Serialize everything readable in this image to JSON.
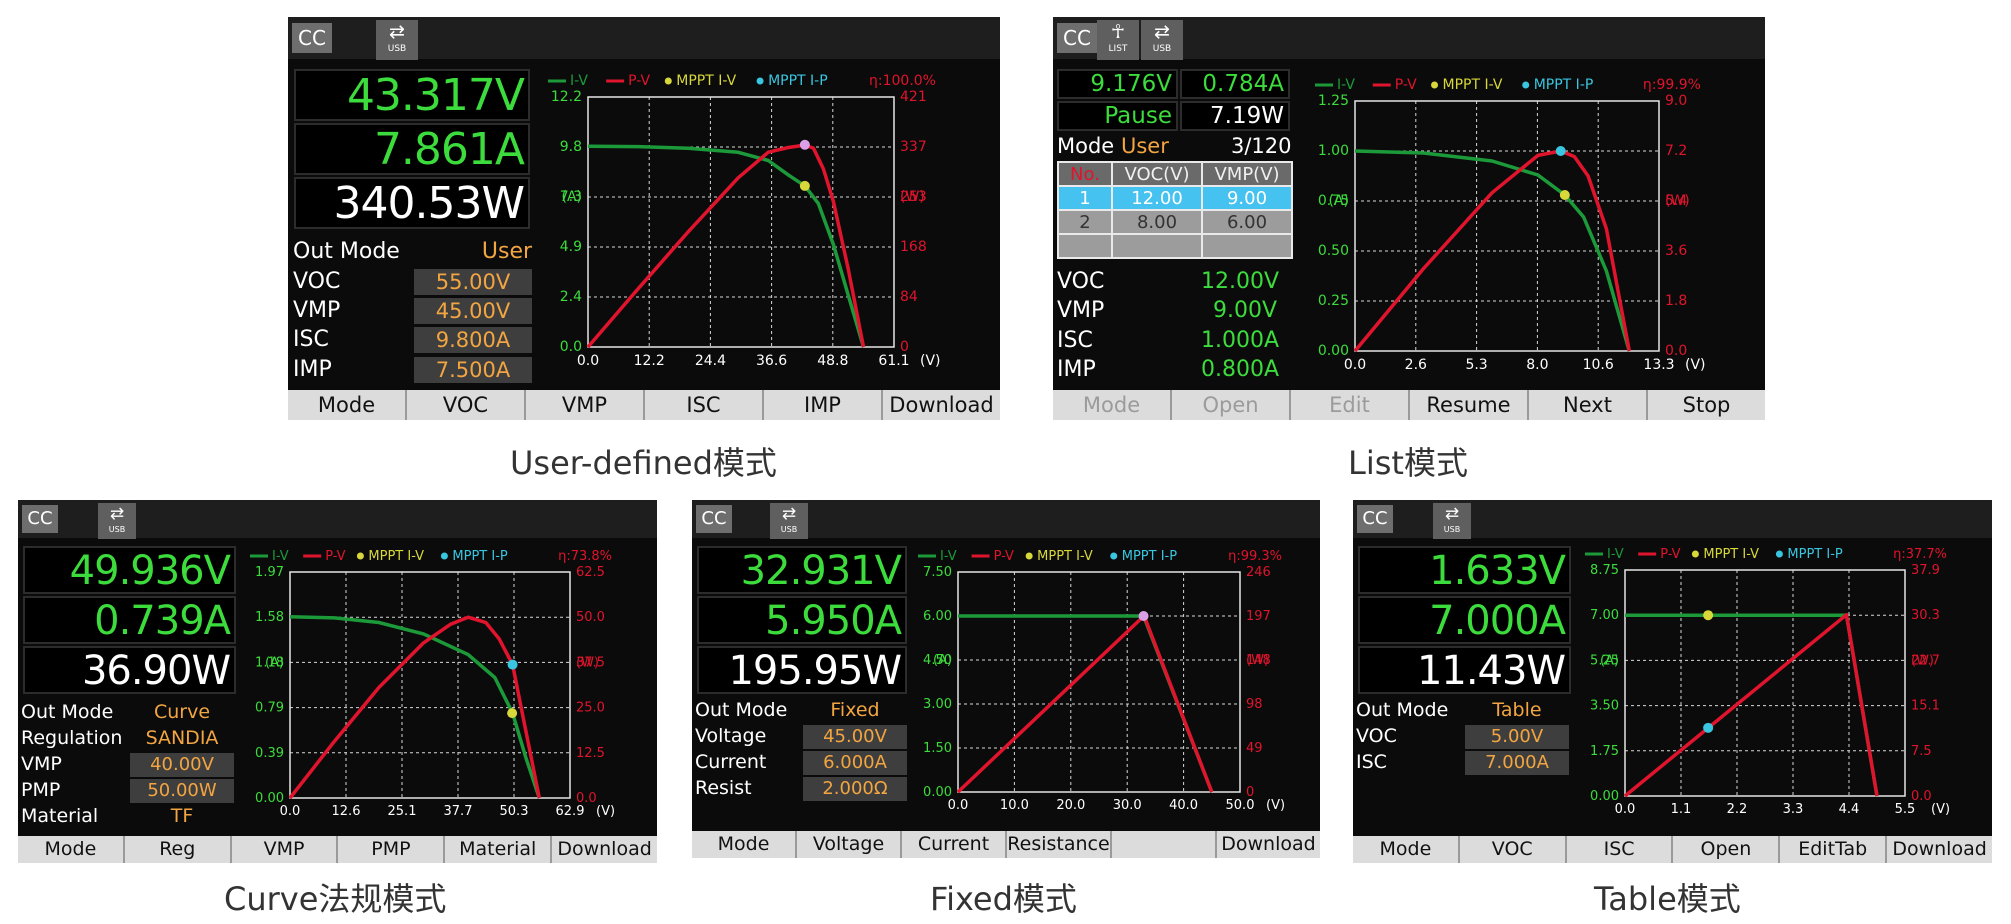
{
  "colors": {
    "green": "#3ddc3d",
    "white": "#ffffff",
    "orange": "#f2a541",
    "iv_curve": "#1c9a3a",
    "pv_curve": "#e0142c",
    "mppt_iv": "#d8d83a",
    "mppt_ip": "#39c6e0",
    "mpp_marker": "#d9a0e8"
  },
  "icons": {
    "usb": "usb-icon",
    "list": "list-run-icon"
  },
  "legend": {
    "iv": "I-V",
    "pv": "P-V",
    "mppt_iv": "MPPT I-V",
    "mppt_ip": "MPPT I-P"
  },
  "units": {
    "left": "(A)",
    "right": "(W)",
    "bottom": "(V)"
  },
  "panels": {
    "user": {
      "caption": "User-defined模式",
      "status": {
        "cc": "CC",
        "usb": "USB"
      },
      "readings": {
        "voltage": "43.317V",
        "current": "7.861A",
        "power": "340.53W"
      },
      "params": [
        {
          "label": "Out Mode",
          "value": "User"
        },
        {
          "label": "VOC",
          "value": "55.00V"
        },
        {
          "label": "VMP",
          "value": "45.00V"
        },
        {
          "label": "ISC",
          "value": "9.800A"
        },
        {
          "label": "IMP",
          "value": "7.500A"
        }
      ],
      "eta": "η:100.0%",
      "softkeys": [
        "Mode",
        "VOC",
        "VMP",
        "ISC",
        "IMP",
        "Download"
      ]
    },
    "list": {
      "caption": "List模式",
      "status": {
        "cc": "CC",
        "list": "LIST",
        "usb": "USB"
      },
      "readings": {
        "voltage": "9.176V",
        "current": "0.784A",
        "state": "Pause",
        "power": "7.19W"
      },
      "mode": {
        "label": "Mode",
        "value": "User",
        "step": "3/120"
      },
      "table": {
        "headers": [
          "No.",
          "VOC(V)",
          "VMP(V)"
        ],
        "rows": [
          [
            "1",
            "12.00",
            "9.00"
          ],
          [
            "2",
            "8.00",
            "6.00"
          ]
        ]
      },
      "params": [
        {
          "label": "VOC",
          "value": "12.00V"
        },
        {
          "label": "VMP",
          "value": "9.00V"
        },
        {
          "label": "ISC",
          "value": "1.000A"
        },
        {
          "label": "IMP",
          "value": "0.800A"
        }
      ],
      "eta": "η:99.9%",
      "softkeys": [
        "Mode",
        "Open",
        "Edit",
        "Resume",
        "Next",
        "Stop"
      ],
      "softkeys_disabled": [
        "Mode",
        "Open",
        "Edit"
      ]
    },
    "curve": {
      "caption": "Curve法规模式",
      "status": {
        "cc": "CC",
        "usb": "USB"
      },
      "readings": {
        "voltage": "49.936V",
        "current": "0.739A",
        "power": "36.90W"
      },
      "params": [
        {
          "label": "Out Mode",
          "value": "Curve"
        },
        {
          "label": "Regulation",
          "value": "SANDIA"
        },
        {
          "label": "VMP",
          "value": "40.00V"
        },
        {
          "label": "PMP",
          "value": "50.00W"
        },
        {
          "label": "Material",
          "value": "TF"
        }
      ],
      "eta": "η:73.8%",
      "softkeys": [
        "Mode",
        "Reg",
        "VMP",
        "PMP",
        "Material",
        "Download"
      ]
    },
    "fixed": {
      "caption": "Fixed模式",
      "status": {
        "cc": "CC",
        "usb": "USB"
      },
      "readings": {
        "voltage": "32.931V",
        "current": "5.950A",
        "power": "195.95W"
      },
      "params": [
        {
          "label": "Out Mode",
          "value": "Fixed"
        },
        {
          "label": "Voltage",
          "value": "45.00V"
        },
        {
          "label": "Current",
          "value": "6.000A"
        },
        {
          "label": "Resist",
          "value": "2.000Ω"
        }
      ],
      "eta": "η:99.3%",
      "softkeys": [
        "Mode",
        "Voltage",
        "Current",
        "Resistance",
        "",
        "Download"
      ]
    },
    "table": {
      "caption": "Table模式",
      "status": {
        "cc": "CC",
        "usb": "USB"
      },
      "readings": {
        "voltage": "1.633V",
        "current": "7.000A",
        "power": "11.43W"
      },
      "params": [
        {
          "label": "Out Mode",
          "value": "Table"
        },
        {
          "label": "VOC",
          "value": "5.00V"
        },
        {
          "label": "ISC",
          "value": "7.000A"
        }
      ],
      "eta": "η:37.7%",
      "softkeys": [
        "Mode",
        "VOC",
        "ISC",
        "Open",
        "EditTab",
        "Download"
      ]
    }
  },
  "chart_data": [
    {
      "type": "line",
      "panel": "user",
      "x_ticks": [
        "0.0",
        "12.2",
        "24.4",
        "36.6",
        "48.8",
        "61.1"
      ],
      "y_left_ticks": [
        "0.0",
        "2.4",
        "4.9",
        "7.3",
        "9.8",
        "12.2"
      ],
      "y_right_ticks": [
        "0",
        "84",
        "168",
        "253",
        "337",
        "421"
      ],
      "xlim": [
        0,
        61.1
      ],
      "ylim_left": [
        0,
        12.2
      ],
      "ylim_right": [
        0,
        421
      ],
      "series": [
        {
          "name": "I-V",
          "axis": "left",
          "points": [
            [
              0,
              9.8
            ],
            [
              10,
              9.78
            ],
            [
              20,
              9.7
            ],
            [
              30,
              9.5
            ],
            [
              36,
              9.1
            ],
            [
              40,
              8.4
            ],
            [
              43.3,
              7.86
            ],
            [
              46,
              7.0
            ],
            [
              49,
              5.0
            ],
            [
              52,
              2.5
            ],
            [
              55,
              0
            ]
          ]
        },
        {
          "name": "P-V",
          "axis": "right",
          "points": [
            [
              0,
              0
            ],
            [
              10,
              98
            ],
            [
              20,
              194
            ],
            [
              30,
              285
            ],
            [
              36,
              328
            ],
            [
              40,
              336
            ],
            [
              43.3,
              340
            ],
            [
              45,
              335
            ],
            [
              47,
              300
            ],
            [
              49,
              245
            ],
            [
              52,
              130
            ],
            [
              55,
              0
            ]
          ]
        }
      ],
      "markers": [
        {
          "name": "MPPT I-V",
          "axis": "left",
          "x": 43.3,
          "y": 7.86
        },
        {
          "name": "MPP",
          "axis": "right",
          "x": 43.3,
          "y": 340.5
        }
      ],
      "grid": true
    },
    {
      "type": "line",
      "panel": "list",
      "x_ticks": [
        "0.0",
        "2.6",
        "5.3",
        "8.0",
        "10.6",
        "13.3"
      ],
      "y_left_ticks": [
        "0.00",
        "0.25",
        "0.50",
        "0.75",
        "1.00",
        "1.25"
      ],
      "y_right_ticks": [
        "0.0",
        "1.8",
        "3.6",
        "5.4",
        "7.2",
        "9.0"
      ],
      "xlim": [
        0,
        13.3
      ],
      "ylim_left": [
        0,
        1.25
      ],
      "ylim_right": [
        0,
        9.0
      ],
      "series": [
        {
          "name": "I-V",
          "axis": "left",
          "points": [
            [
              0,
              1.0
            ],
            [
              3,
              0.99
            ],
            [
              6,
              0.95
            ],
            [
              8,
              0.88
            ],
            [
              9.18,
              0.78
            ],
            [
              10,
              0.67
            ],
            [
              11,
              0.4
            ],
            [
              12,
              0
            ]
          ]
        },
        {
          "name": "P-V",
          "axis": "right",
          "points": [
            [
              0,
              0
            ],
            [
              3,
              2.97
            ],
            [
              6,
              5.7
            ],
            [
              8,
              7.04
            ],
            [
              9,
              7.2
            ],
            [
              9.6,
              7.0
            ],
            [
              10.2,
              6.3
            ],
            [
              11,
              4.4
            ],
            [
              12,
              0
            ]
          ]
        }
      ],
      "markers": [
        {
          "name": "MPPT I-V",
          "axis": "left",
          "x": 9.18,
          "y": 0.78
        },
        {
          "name": "MPPT I-P",
          "axis": "right",
          "x": 9.0,
          "y": 7.2
        }
      ],
      "grid": true
    },
    {
      "type": "line",
      "panel": "curve",
      "x_ticks": [
        "0.0",
        "12.6",
        "25.1",
        "37.7",
        "50.3",
        "62.9"
      ],
      "y_left_ticks": [
        "0.00",
        "0.39",
        "0.79",
        "1.18",
        "1.58",
        "1.97"
      ],
      "y_right_ticks": [
        "0.0",
        "12.5",
        "25.0",
        "37.5",
        "50.0",
        "62.5"
      ],
      "xlim": [
        0,
        62.9
      ],
      "ylim_left": [
        0,
        1.97
      ],
      "ylim_right": [
        0,
        62.5
      ],
      "series": [
        {
          "name": "I-V",
          "axis": "left",
          "points": [
            [
              0,
              1.58
            ],
            [
              10,
              1.57
            ],
            [
              20,
              1.53
            ],
            [
              30,
              1.43
            ],
            [
              40,
              1.25
            ],
            [
              46,
              1.05
            ],
            [
              50,
              0.74
            ],
            [
              53,
              0.35
            ],
            [
              56,
              0
            ]
          ]
        },
        {
          "name": "P-V",
          "axis": "right",
          "points": [
            [
              0,
              0
            ],
            [
              10,
              15.7
            ],
            [
              20,
              30.6
            ],
            [
              30,
              42.9
            ],
            [
              36,
              48
            ],
            [
              40,
              50
            ],
            [
              44,
              48.5
            ],
            [
              47,
              44
            ],
            [
              50,
              36.9
            ],
            [
              53,
              18.5
            ],
            [
              56,
              0
            ]
          ]
        }
      ],
      "markers": [
        {
          "name": "MPPT I-P",
          "axis": "right",
          "x": 50,
          "y": 36.9
        },
        {
          "name": "MPPT I-V",
          "axis": "left",
          "x": 49.9,
          "y": 0.74
        }
      ],
      "grid": true
    },
    {
      "type": "line",
      "panel": "fixed",
      "x_ticks": [
        "0.0",
        "10.0",
        "20.0",
        "30.0",
        "40.0",
        "50.0"
      ],
      "y_left_ticks": [
        "0.00",
        "1.50",
        "3.00",
        "4.50",
        "6.00",
        "7.50"
      ],
      "y_right_ticks": [
        "0",
        "49",
        "98",
        "148",
        "197",
        "246"
      ],
      "xlim": [
        0,
        50
      ],
      "ylim_left": [
        0,
        7.5
      ],
      "ylim_right": [
        0,
        246
      ],
      "series": [
        {
          "name": "I-V",
          "axis": "left",
          "points": [
            [
              0,
              6.0
            ],
            [
              32.9,
              6.0
            ],
            [
              45,
              0
            ]
          ]
        },
        {
          "name": "P-V",
          "axis": "right",
          "points": [
            [
              0,
              0
            ],
            [
              33,
              197
            ],
            [
              45,
              0
            ]
          ]
        }
      ],
      "markers": [
        {
          "name": "MPP",
          "axis": "left",
          "x": 32.9,
          "y": 6.0
        }
      ],
      "grid": true
    },
    {
      "type": "line",
      "panel": "table",
      "x_ticks": [
        "0.0",
        "1.1",
        "2.2",
        "3.3",
        "4.4",
        "5.5"
      ],
      "y_left_ticks": [
        "0.00",
        "1.75",
        "3.50",
        "5.25",
        "7.00",
        "8.75"
      ],
      "y_right_ticks": [
        "0.0",
        "7.5",
        "15.1",
        "22.7",
        "30.3",
        "37.9"
      ],
      "xlim": [
        0,
        5.5
      ],
      "ylim_left": [
        0,
        8.75
      ],
      "ylim_right": [
        0,
        37.9
      ],
      "series": [
        {
          "name": "I-V",
          "axis": "left",
          "points": [
            [
              0,
              7.0
            ],
            [
              4.35,
              7.0
            ],
            [
              4.95,
              0
            ]
          ]
        },
        {
          "name": "P-V",
          "axis": "right",
          "points": [
            [
              0,
              0
            ],
            [
              4.35,
              30.4
            ],
            [
              4.95,
              0
            ]
          ]
        }
      ],
      "markers": [
        {
          "name": "MPPT I-V",
          "axis": "left",
          "x": 1.633,
          "y": 7.0
        },
        {
          "name": "MPPT I-P",
          "axis": "right",
          "x": 1.633,
          "y": 11.43
        }
      ],
      "grid": true
    }
  ]
}
